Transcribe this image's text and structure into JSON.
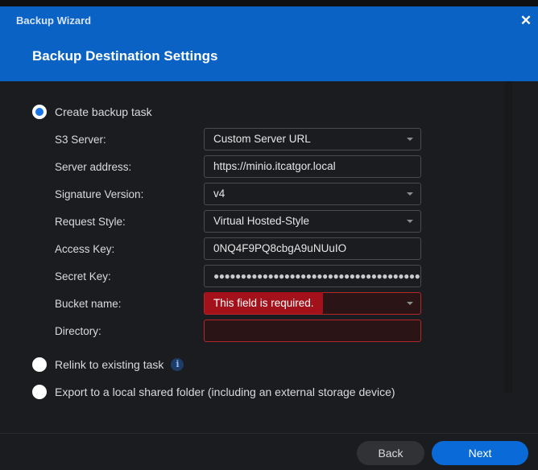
{
  "window": {
    "title": "Backup Wizard",
    "close_icon": "close-icon"
  },
  "header": {
    "page_title": "Backup Destination Settings"
  },
  "options": {
    "create": {
      "label": "Create backup task",
      "selected": true
    },
    "relink": {
      "label": "Relink to existing task",
      "info_icon": "info-icon",
      "info_glyph": "i"
    },
    "export": {
      "label": "Export to a local shared folder (including an external storage device)"
    }
  },
  "form": {
    "s3_server": {
      "label": "S3 Server:",
      "value": "Custom Server URL"
    },
    "server_address": {
      "label": "Server address:",
      "value": "https://minio.itcatgor.local"
    },
    "signature_version": {
      "label": "Signature Version:",
      "value": "v4"
    },
    "request_style": {
      "label": "Request Style:",
      "value": "Virtual Hosted-Style"
    },
    "access_key": {
      "label": "Access Key:",
      "value": "0NQ4F9PQ8cbgA9uNUuIO"
    },
    "secret_key": {
      "label": "Secret Key:",
      "value": "●●●●●●●●●●●●●●●●●●●●●●●●●●●●●●●●●●●●●●●"
    },
    "bucket_name": {
      "label": "Bucket name:",
      "value": "",
      "error": "This field is required."
    },
    "directory": {
      "label": "Directory:",
      "value": ""
    }
  },
  "footer": {
    "back_label": "Back",
    "next_label": "Next"
  },
  "colors": {
    "header_bg": "#0a62c4",
    "accent": "#0a6bd8",
    "error": "#a3121a"
  }
}
